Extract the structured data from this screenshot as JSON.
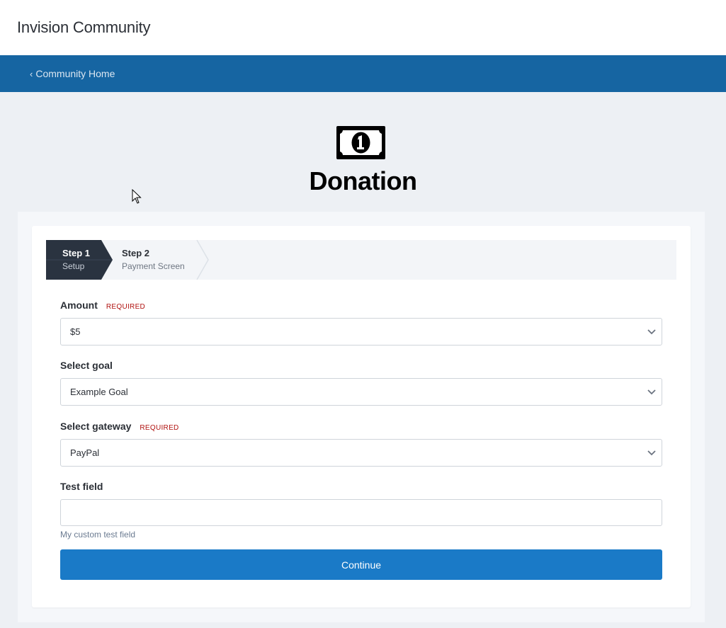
{
  "header": {
    "site_title": "Invision Community"
  },
  "navbar": {
    "back_link": "Community Home"
  },
  "hero": {
    "title": "Donation",
    "icon": "money-bill-icon"
  },
  "steps": [
    {
      "label": "Step 1",
      "sub": "Setup",
      "active": true
    },
    {
      "label": "Step 2",
      "sub": "Payment Screen",
      "active": false
    }
  ],
  "form": {
    "amount": {
      "label": "Amount",
      "required": "REQUIRED",
      "value": "$5"
    },
    "goal": {
      "label": "Select goal",
      "value": "Example Goal"
    },
    "gateway": {
      "label": "Select gateway",
      "required": "REQUIRED",
      "value": "PayPal"
    },
    "test_field": {
      "label": "Test field",
      "value": "",
      "hint": "My custom test field"
    },
    "submit_label": "Continue"
  },
  "colors": {
    "brand": "#1665a2",
    "button": "#1a7ac7",
    "active_step": "#2a3340",
    "required": "#b0110f"
  }
}
